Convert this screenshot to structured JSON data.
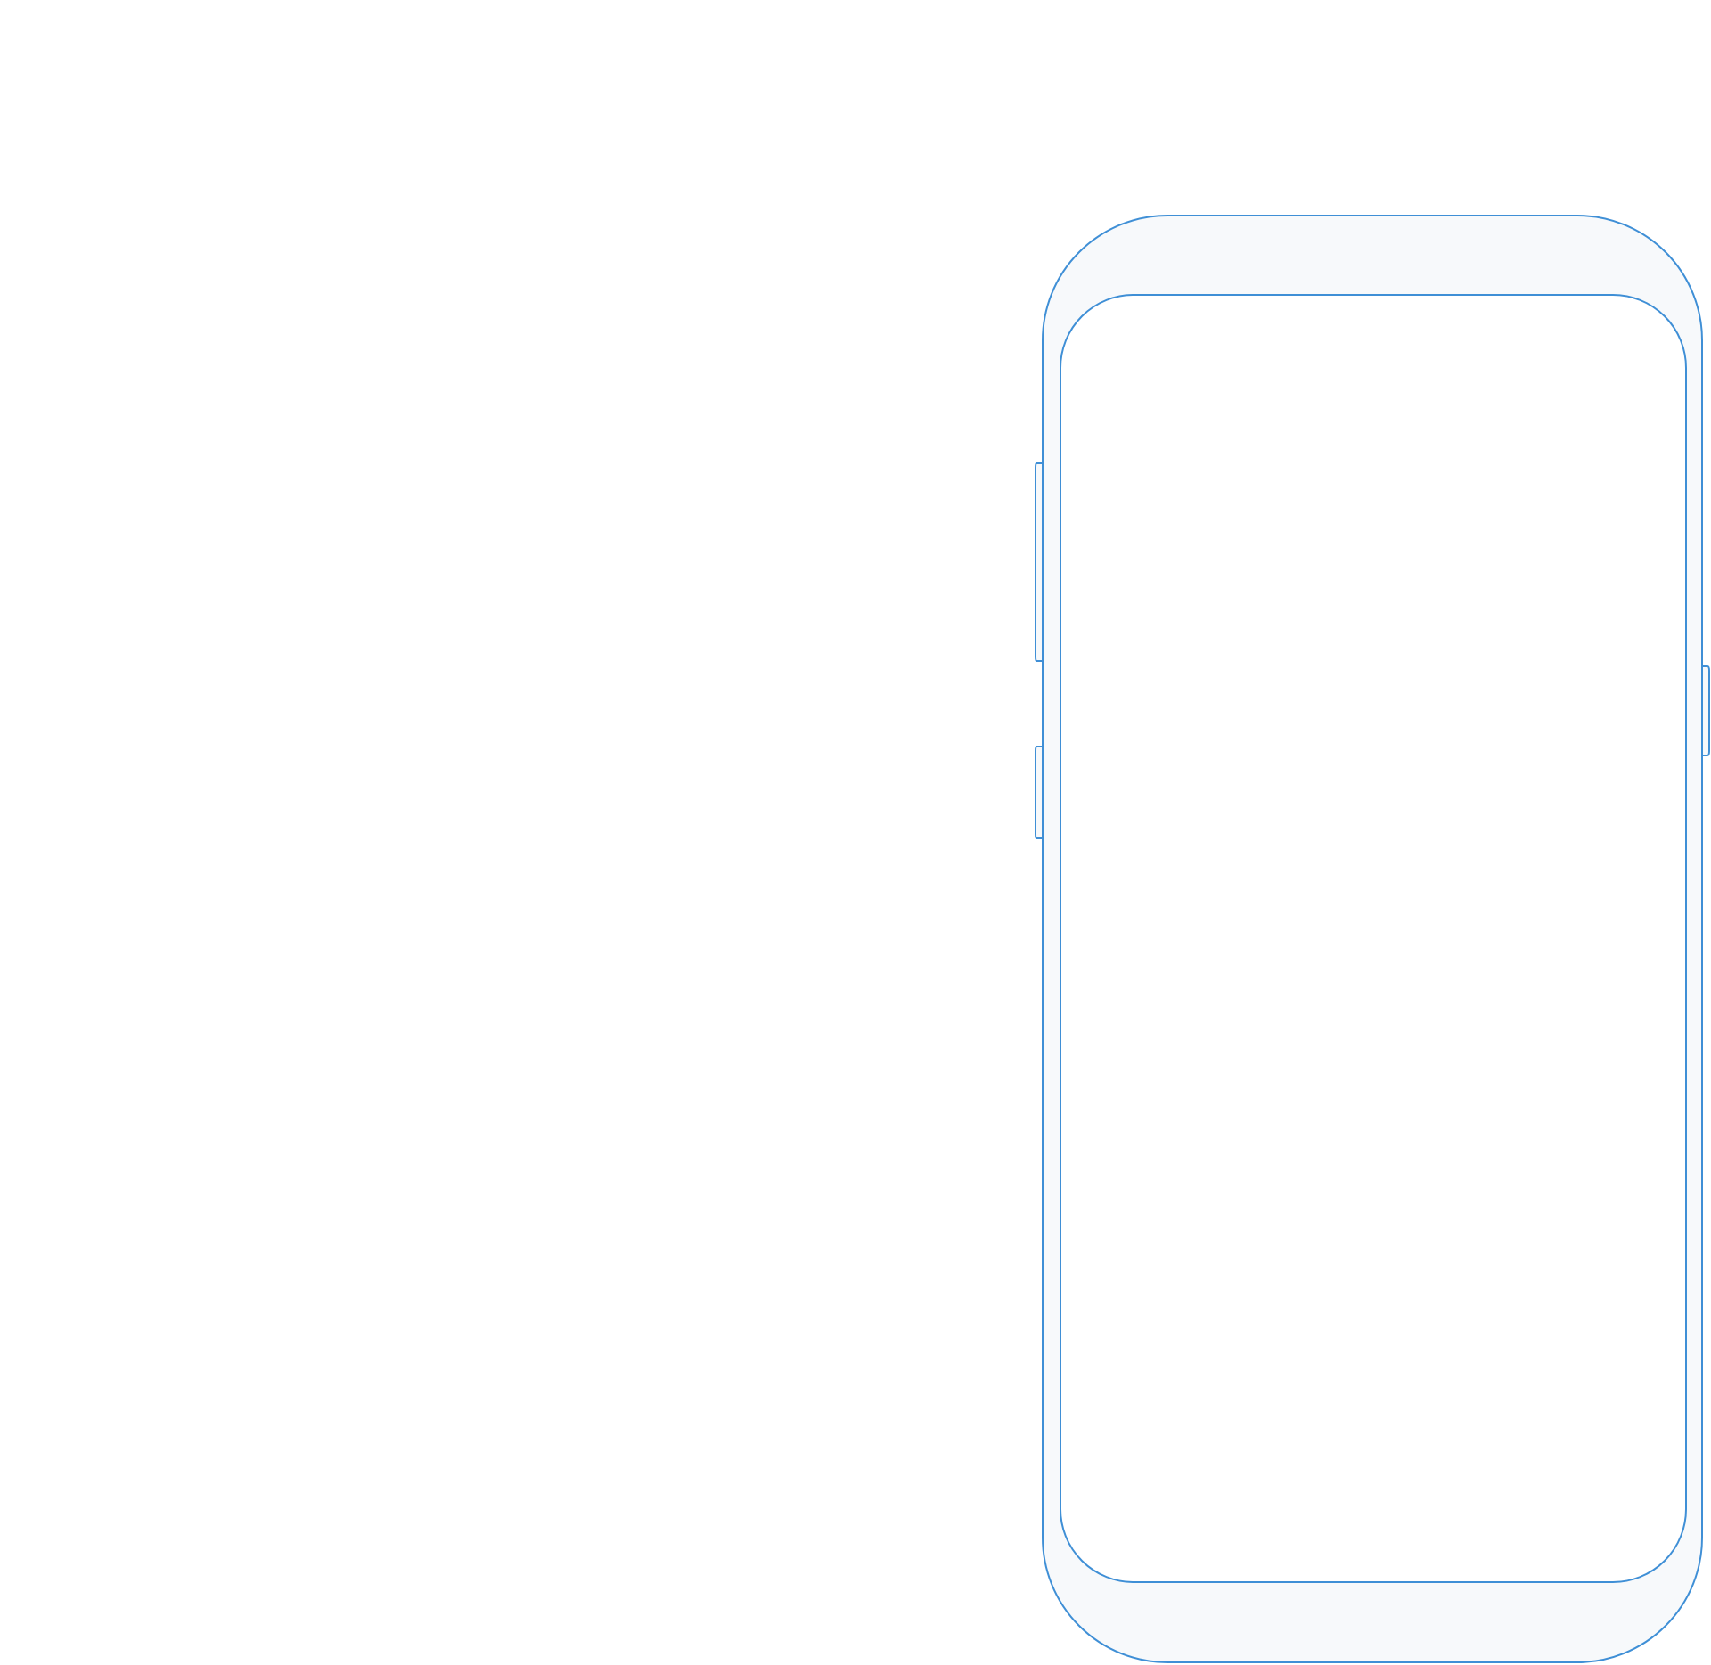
{
  "device": {
    "type": "smartphone",
    "screen_content": "",
    "colors": {
      "outline": "#3f8fd6",
      "bezel_fill": "#f7f9fb",
      "screen_fill": "#ffffff",
      "page_background": "#ffffff"
    }
  }
}
